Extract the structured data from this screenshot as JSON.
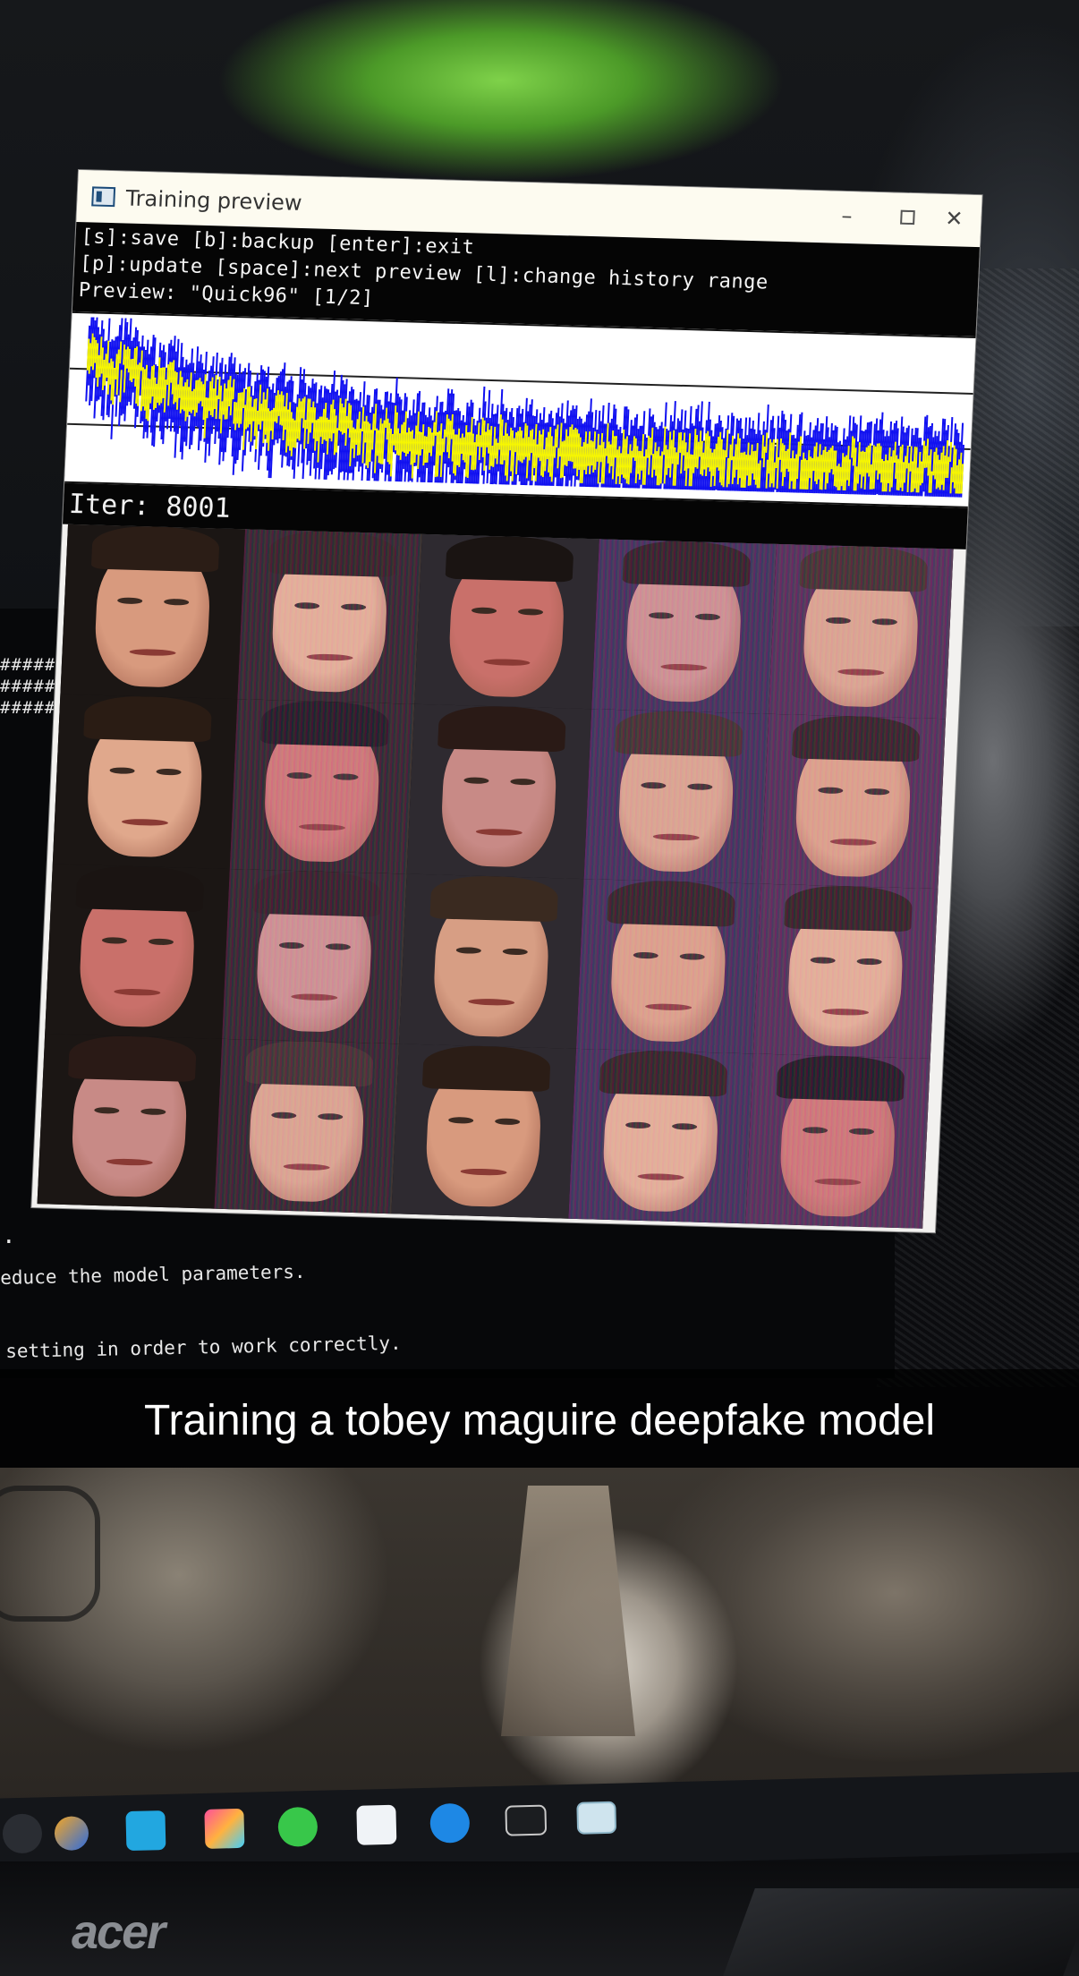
{
  "window": {
    "title": "Training preview",
    "controls": {
      "minimize": "–",
      "close": "✕"
    },
    "help_lines": [
      "[s]:save [b]:backup [enter]:exit",
      "[p]:update [space]:next preview [l]:change history range",
      "Preview: \"Quick96\" [1/2]"
    ],
    "iter_label": "Iter: 8001",
    "loss_graph": {
      "series": [
        {
          "color": "#1010f0"
        },
        {
          "color": "#f8f800"
        }
      ]
    }
  },
  "terminal": {
    "hash_rows": [
      "######",
      "######",
      "######"
    ],
    "dot": ".",
    "line1": "educe the model parameters.",
    "line2": "setting in order to work correctly."
  },
  "caption": {
    "text": "Training a tobey maguire deepfake model"
  },
  "taskbar": {
    "icons": [
      "windows-icon",
      "blender-icon",
      "c-app-icon",
      "colorful-app-icon",
      "green-app-icon",
      "o-app-icon",
      "blue-app-icon",
      "terminal-icon",
      "preview-window-icon"
    ]
  },
  "monitor": {
    "brand": "acer"
  }
}
